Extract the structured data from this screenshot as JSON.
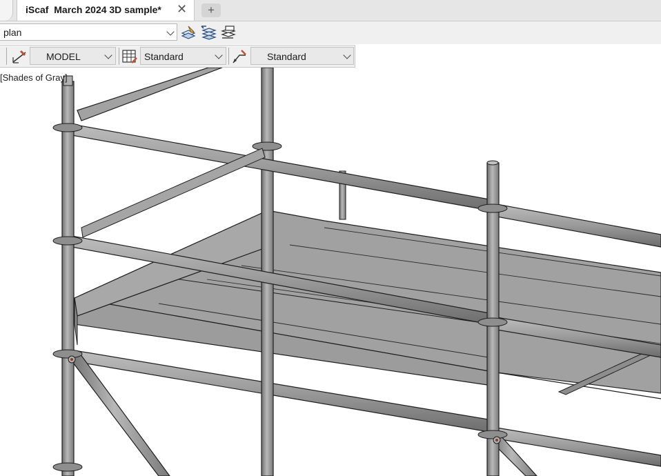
{
  "tabs": {
    "active_title": "iScaf  March 2024 3D sample*",
    "close_glyph": "✕",
    "add_glyph": "+"
  },
  "toolbar1": {
    "layer_value": "plan",
    "buttons": [
      "layer-properties-icon",
      "layer-states-icon",
      "layer-previous-icon"
    ]
  },
  "toolbar2": {
    "space_value": "MODEL",
    "table_style_value": "Standard",
    "multileader_style_value": "Standard"
  },
  "viewport": {
    "visual_style_label": "[Shades of Gray]"
  },
  "colors": {
    "steel": "#9a9a9a",
    "steel_dark": "#6f6f6f",
    "deck": "#a3a3a3",
    "outline": "#1e1e1e"
  }
}
